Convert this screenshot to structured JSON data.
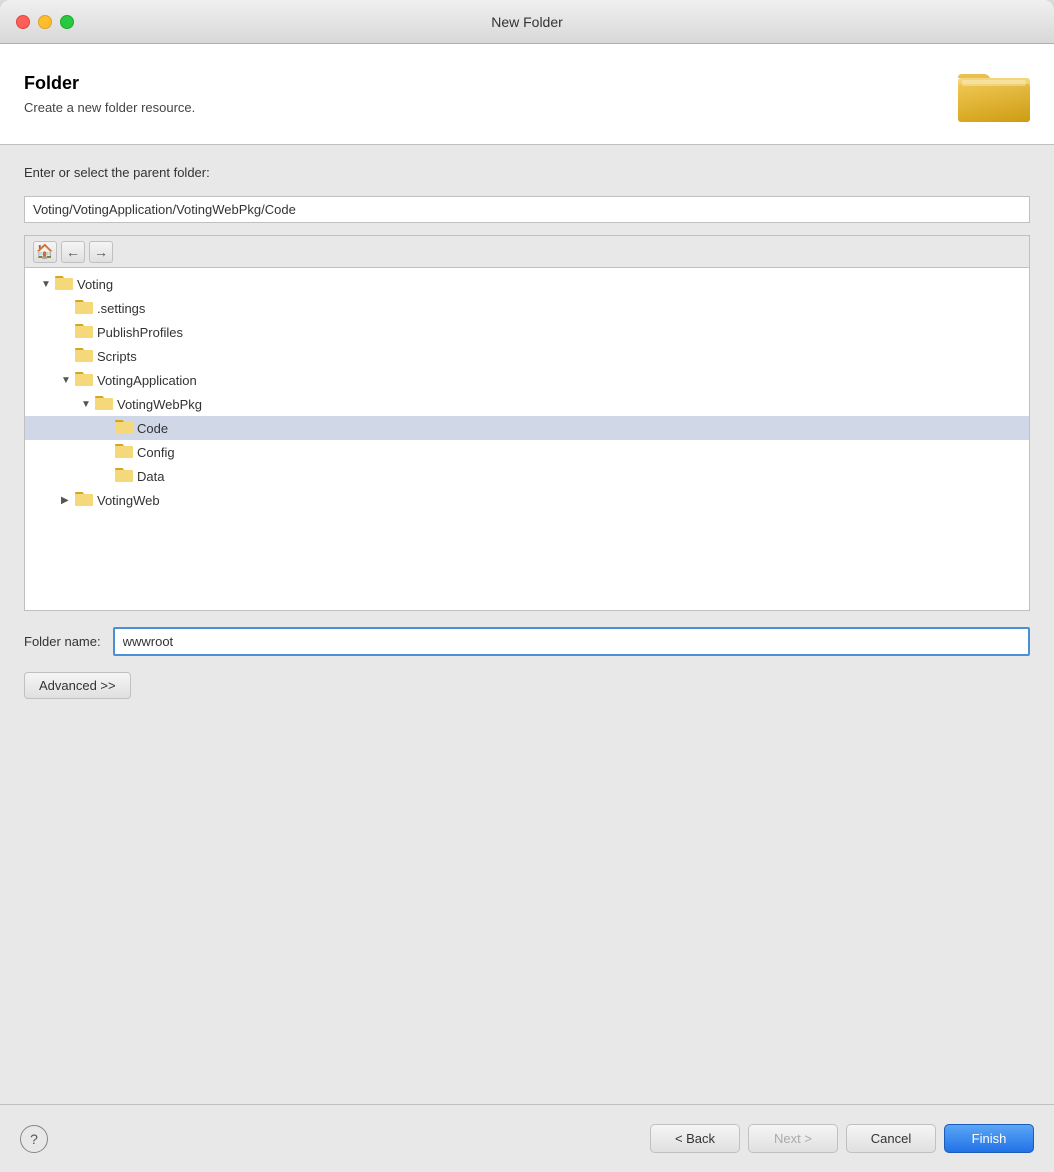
{
  "window": {
    "title": "New Folder"
  },
  "header": {
    "title": "Folder",
    "subtitle": "Create a new folder resource."
  },
  "parent_folder": {
    "label": "Enter or select the parent folder:",
    "value": "Voting/VotingApplication/VotingWebPkg/Code"
  },
  "tree": {
    "items": [
      {
        "id": "voting",
        "label": "Voting",
        "level": 0,
        "arrow": "▼",
        "expanded": true,
        "project": true
      },
      {
        "id": "settings",
        "label": ".settings",
        "level": 1,
        "arrow": "",
        "expanded": false
      },
      {
        "id": "publishprofiles",
        "label": "PublishProfiles",
        "level": 1,
        "arrow": "",
        "expanded": false
      },
      {
        "id": "scripts",
        "label": "Scripts",
        "level": 1,
        "arrow": "",
        "expanded": false
      },
      {
        "id": "votingapplication",
        "label": "VotingApplication",
        "level": 1,
        "arrow": "▼",
        "expanded": true
      },
      {
        "id": "votingwebpkg",
        "label": "VotingWebPkg",
        "level": 2,
        "arrow": "▼",
        "expanded": true
      },
      {
        "id": "code",
        "label": "Code",
        "level": 3,
        "arrow": "",
        "expanded": false,
        "selected": true
      },
      {
        "id": "config",
        "label": "Config",
        "level": 3,
        "arrow": "",
        "expanded": false
      },
      {
        "id": "data",
        "label": "Data",
        "level": 3,
        "arrow": "",
        "expanded": false
      },
      {
        "id": "votingweb",
        "label": "VotingWeb",
        "level": 1,
        "arrow": "▶",
        "expanded": false
      }
    ]
  },
  "folder_name": {
    "label": "Folder name:",
    "value": "wwwroot"
  },
  "buttons": {
    "advanced": "Advanced >>",
    "back": "< Back",
    "next": "Next >",
    "cancel": "Cancel",
    "finish": "Finish"
  }
}
